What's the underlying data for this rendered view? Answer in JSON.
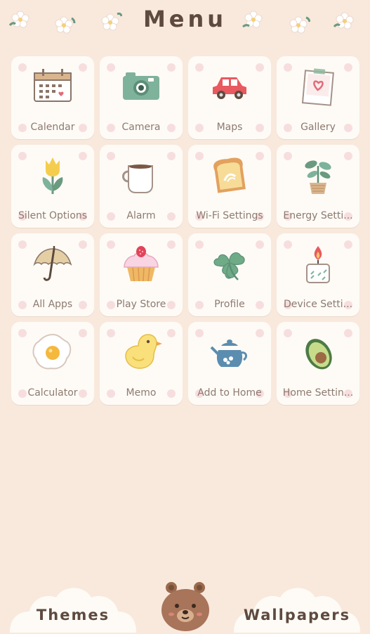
{
  "header": {
    "title": "Menu"
  },
  "apps": [
    {
      "label": "Calendar",
      "icon": "calendar-icon"
    },
    {
      "label": "Camera",
      "icon": "camera-icon"
    },
    {
      "label": "Maps",
      "icon": "car-icon"
    },
    {
      "label": "Gallery",
      "icon": "photo-icon"
    },
    {
      "label": "Silent Options",
      "icon": "tulip-icon"
    },
    {
      "label": "Alarm",
      "icon": "mug-icon"
    },
    {
      "label": "Wi-Fi Settings",
      "icon": "toast-icon"
    },
    {
      "label": "Energy Setti...",
      "icon": "plant-icon"
    },
    {
      "label": "All Apps",
      "icon": "umbrella-icon"
    },
    {
      "label": "Play Store",
      "icon": "cupcake-icon"
    },
    {
      "label": "Profile",
      "icon": "clover-icon"
    },
    {
      "label": "Device Setti...",
      "icon": "candle-icon"
    },
    {
      "label": "Calculator",
      "icon": "fried-egg-icon"
    },
    {
      "label": "Memo",
      "icon": "chick-icon"
    },
    {
      "label": "Add to Home",
      "icon": "teapot-icon"
    },
    {
      "label": "Home Settin...",
      "icon": "avocado-icon"
    }
  ],
  "bottom": {
    "themes_label": "Themes",
    "wallpapers_label": "Wallpapers"
  },
  "colors": {
    "background": "#f8e9dc",
    "tile": "#fefbf6",
    "tile_dot": "#f7dede",
    "title_text": "#5e4a3f",
    "label_text": "#8d7a70"
  }
}
